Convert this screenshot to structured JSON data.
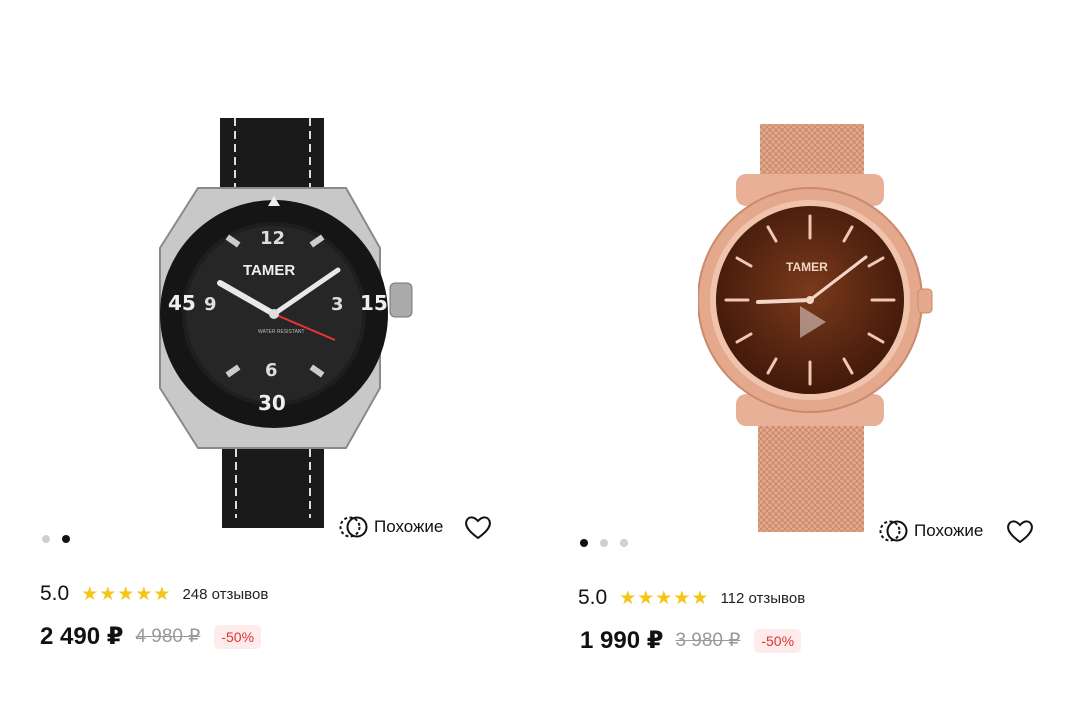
{
  "products": [
    {
      "brand_logo": "TAMER",
      "dial_text": "WATER RESISTANT",
      "bezel_numbers": [
        "45",
        "15",
        "30"
      ],
      "dial_numbers": [
        "12",
        "3",
        "6",
        "9"
      ],
      "image_dots": {
        "count": 2,
        "active": 1
      },
      "similar_label": "Похожие",
      "similar_icon": "similar-icon",
      "favorite_icon": "heart-icon",
      "rating": "5.0",
      "stars": 5,
      "reviews": "248 отзывов",
      "price": "2 490 ₽",
      "old_price": "4 980 ₽",
      "discount": "-50%"
    },
    {
      "brand_logo": "TAMER",
      "image_dots": {
        "count": 3,
        "active": 0
      },
      "similar_label": "Похожие",
      "similar_icon": "similar-icon",
      "favorite_icon": "heart-icon",
      "rating": "5.0",
      "stars": 5,
      "reviews": "112 отзывов",
      "price": "1 990 ₽",
      "old_price": "3 980 ₽",
      "discount": "-50%"
    }
  ],
  "colors": {
    "star": "#f5c518",
    "discount_text": "#e0322e",
    "discount_bg": "#fdeceb",
    "old_price": "#999999"
  }
}
